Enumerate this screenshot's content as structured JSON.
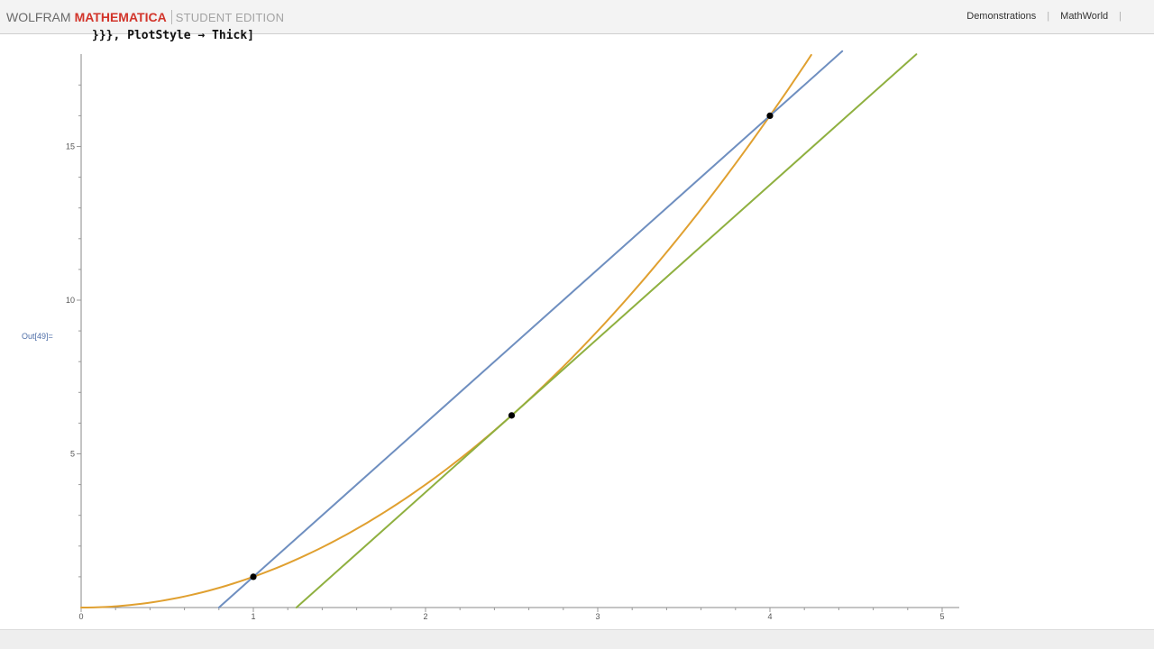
{
  "header": {
    "brand_wolfram": "WOLFRAM",
    "brand_mathematica": "MATHEMATICA",
    "brand_edition": "STUDENT EDITION",
    "links": [
      "Demonstrations",
      "MathWorld"
    ]
  },
  "notebook": {
    "input_fragment": "}}}, PlotStyle → Thick]",
    "output_label": "Out[49]="
  },
  "colors": {
    "curve": "#e0a030",
    "secant": "#6f8fc0",
    "tangent": "#8fb040",
    "points": "#000000",
    "brand_red": "#d2342a"
  },
  "chart_data": {
    "type": "line",
    "title": "",
    "xlabel": "",
    "ylabel": "",
    "xlim": [
      0,
      5
    ],
    "ylim": [
      0,
      18
    ],
    "x_ticks": [
      0,
      1,
      2,
      3,
      4,
      5
    ],
    "y_ticks": [
      5,
      10,
      15
    ],
    "x_tick_labels": [
      "0",
      "1",
      "2",
      "3",
      "4",
      "5"
    ],
    "y_tick_labels": [
      "5",
      "10",
      "15"
    ],
    "grid": false,
    "series": [
      {
        "kind": "curve",
        "function": "x^2",
        "x_range": [
          0,
          4.24
        ]
      },
      {
        "kind": "line",
        "slope": 5,
        "intercept": -4,
        "x_range": [
          0.8,
          4.42
        ]
      },
      {
        "kind": "line",
        "slope": 5,
        "intercept": -6.25,
        "x_range": [
          1.25,
          4.85
        ]
      }
    ],
    "points": [
      {
        "x": 1,
        "y": 1
      },
      {
        "x": 2.5,
        "y": 6.25
      },
      {
        "x": 4,
        "y": 16
      }
    ]
  }
}
